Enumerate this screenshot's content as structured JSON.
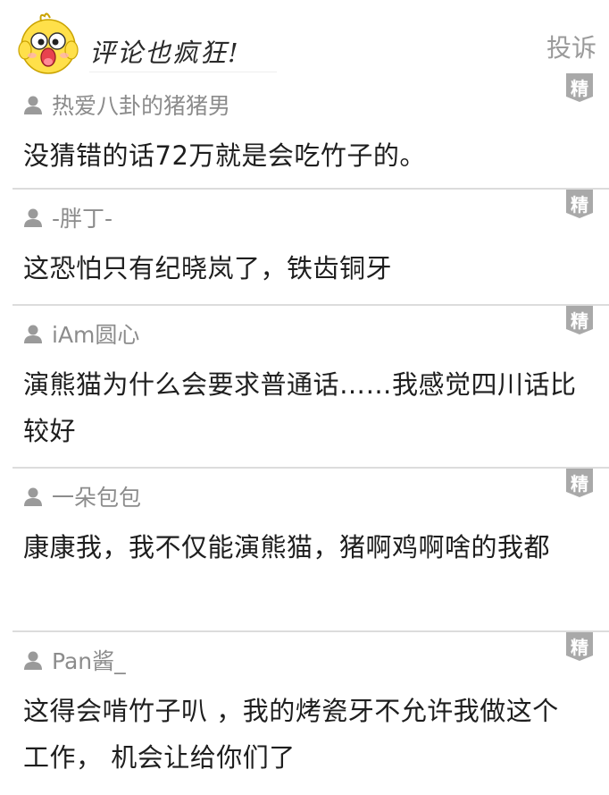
{
  "header": {
    "title": "评论也疯狂!",
    "report_label": "投诉",
    "mascot_icon": "chick-mascot-icon"
  },
  "badge_label": "精",
  "comments": [
    {
      "user": "热爱八卦的猪猪男",
      "text": "没猜错的话72万就是会吃竹子的。"
    },
    {
      "user": "-胖丁-",
      "text": "这恐怕只有纪晓岚了，铁齿铜牙"
    },
    {
      "user": "iAm圆心",
      "text": "演熊猫为什么会要求普通话……我感觉四川话比较好"
    },
    {
      "user": "一朵包包",
      "text": "康康我，我不仅能演熊猫，猪啊鸡啊啥的我都"
    },
    {
      "user": "Pan酱_",
      "text": "这得会啃竹子叭 ，我的烤瓷牙不允许我做这个工作， 机会让给你们了"
    }
  ],
  "colors": {
    "username": "#8c8c8c",
    "divider": "#dcdcdc",
    "badge": "#a9a9a9",
    "report": "#9a9a9a"
  }
}
